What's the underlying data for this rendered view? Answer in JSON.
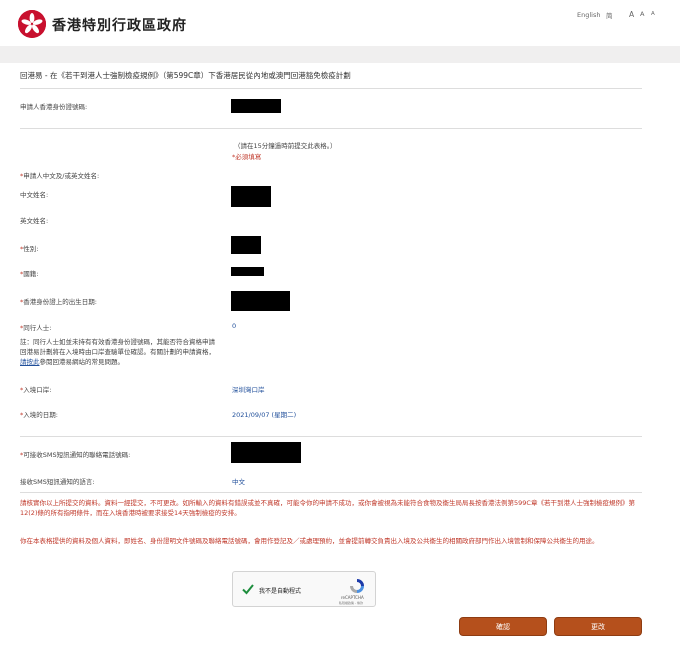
{
  "header": {
    "gov_title": "香港特別行政區政府",
    "lang_english": "English",
    "lang_simplified": "简",
    "font_sizes": [
      "A",
      "A",
      "A"
    ]
  },
  "page": {
    "title": "回港易 - 在《若干到港人士強制檢疫規例》（第599C章）下香港居民從內地或澳門回港豁免檢疫計劃"
  },
  "form": {
    "hkid_label": "申請人香港身份證號碼:",
    "submit_hint": "（請在15分鐘過時前提交此表格。）",
    "required_note": "*必須填寫",
    "name_label": "申請人中文及/或英文姓名:",
    "chinese_name_label": "中文姓名:",
    "english_name_label": "英文姓名:",
    "gender_label": "性別:",
    "nationality_label": "國籍:",
    "dob_label": "香港身份證上的出生日期:",
    "companion_label": "同行人士:",
    "companion_value": "0",
    "remark_prefix": "註：同行人士如並未持有有效香港身份證號碼，其能否符合資格申請回港易計劃將在入境時由口岸查驗單位確認。有關計劃的申請資格，",
    "remark_link": "請按此",
    "remark_suffix": "參閱回港易網站的常見問題。",
    "port_label": "入境口岸:",
    "port_value": "深圳灣口岸",
    "date_label": "入境的日期:",
    "date_value": "2021/09/07 (星期二)",
    "phone_label": "可接收SMS短訊通知的聯絡電話號碼:",
    "sms_lang_label": "接收SMS短訊通知的語言:",
    "sms_lang_value": "中文"
  },
  "warning": {
    "para1": "請核實你以上所提交的資料。資料一經提交，不可更改。如所輸入的資料有錯誤或並不真確，可能令你的申請不成功，或你會被視為未能符合食物及衞生局局長按香港法例第599C章《若干到港人士強制檢疫規例》第12(2)條的所有指明條件，而在入境香港時被要求接受14天強制檢疫的安排。",
    "para2": "你在本表格提供的資料及個人資料，即姓名、身份證明文件號碼及聯絡電話號碼，會用作登記及／或處理預約，並會提前轉交負責出入境及公共衞生的相關政府部門作出入境管制和保障公共衞生的用途。"
  },
  "captcha": {
    "label": "我不是自動程式",
    "brand": "reCAPTCHA",
    "terms": "私隱權政策 - 條款"
  },
  "buttons": {
    "confirm": "確認",
    "modify": "更改"
  },
  "colors": {
    "accent": "#b5501c",
    "required": "#c0392b",
    "value_text": "#1f4e9a",
    "logo_red": "#c8102e"
  }
}
